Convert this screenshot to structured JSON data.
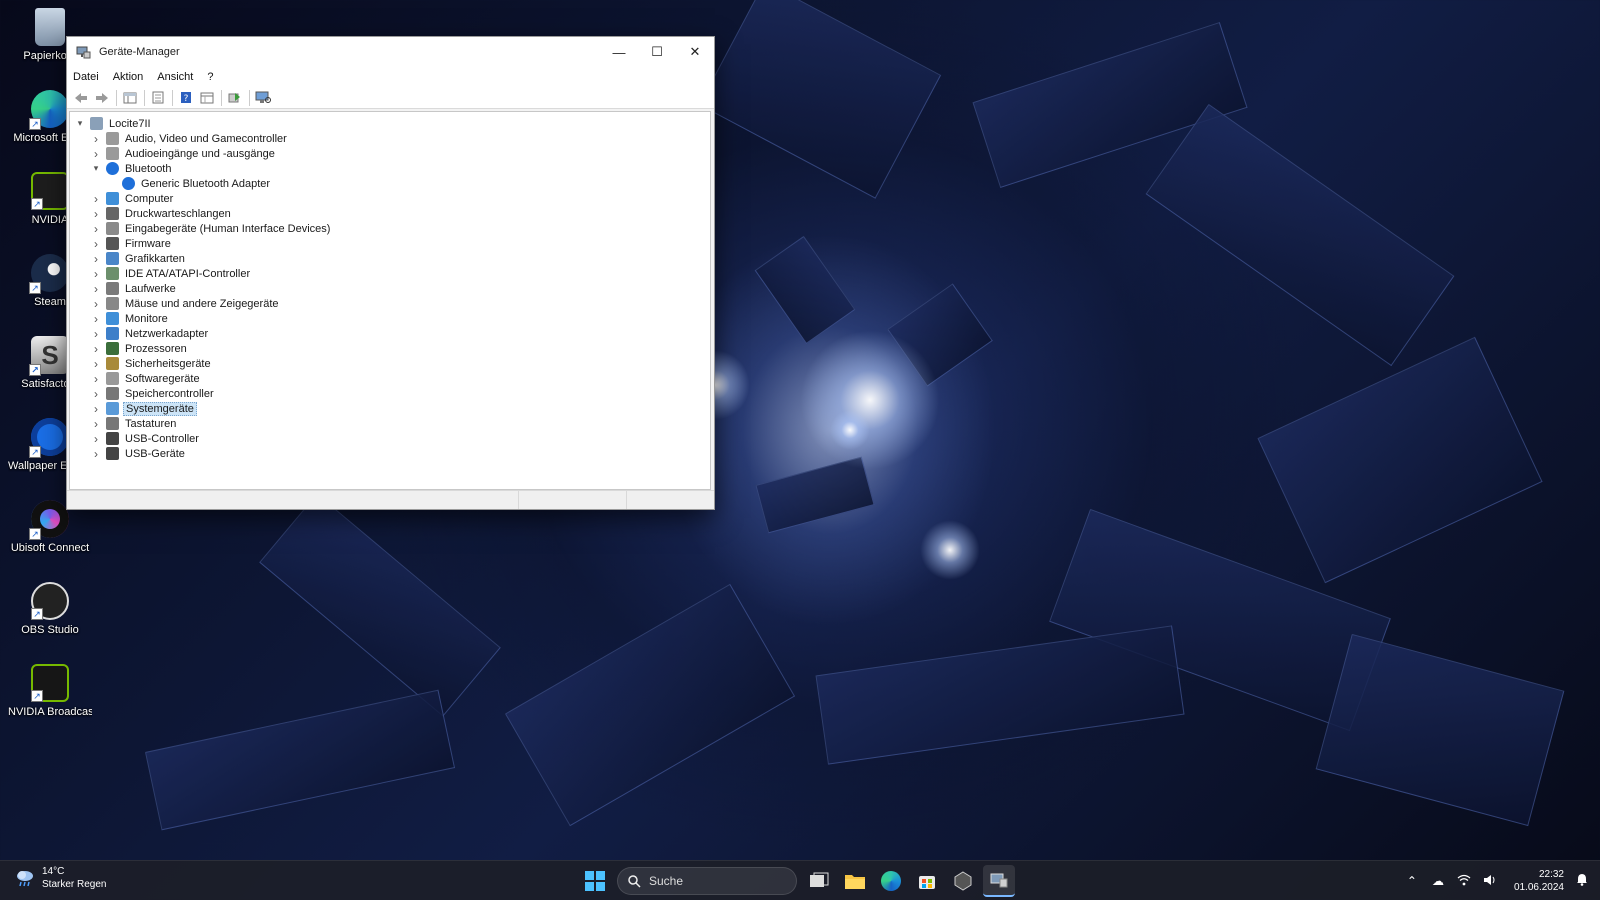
{
  "desktop_icons": [
    {
      "label": "Papierkorb",
      "icon": "recycle-bin-icon"
    },
    {
      "label": "Microsoft Edge",
      "icon": "edge-icon"
    },
    {
      "label": "NVIDIA",
      "icon": "nvidia-icon"
    },
    {
      "label": "Steam",
      "icon": "steam-icon"
    },
    {
      "label": "Satisfactory",
      "icon": "satisfactory-icon"
    },
    {
      "label": "Wallpaper Engine",
      "icon": "wallpaper-engine-icon"
    },
    {
      "label": "Ubisoft Connect",
      "icon": "ubisoft-icon"
    },
    {
      "label": "OBS Studio",
      "icon": "obs-icon"
    },
    {
      "label": "NVIDIA Broadcast",
      "icon": "nvidia-broadcast-icon"
    }
  ],
  "window": {
    "title": "Geräte-Manager",
    "menu": [
      "Datei",
      "Aktion",
      "Ansicht",
      "?"
    ],
    "tree": {
      "root": "Locite7II",
      "items": [
        {
          "label": "Audio, Video und Gamecontroller",
          "icon": "speaker-icon",
          "expanded": false
        },
        {
          "label": "Audioeingänge und -ausgänge",
          "icon": "speaker-icon",
          "expanded": false
        },
        {
          "label": "Bluetooth",
          "icon": "bluetooth-icon",
          "expanded": true,
          "children": [
            "Generic Bluetooth Adapter"
          ]
        },
        {
          "label": "Computer",
          "icon": "monitor-icon",
          "expanded": false
        },
        {
          "label": "Druckwarteschlangen",
          "icon": "printer-icon",
          "expanded": false
        },
        {
          "label": "Eingabegeräte (Human Interface Devices)",
          "icon": "hid-icon",
          "expanded": false
        },
        {
          "label": "Firmware",
          "icon": "chip-icon",
          "expanded": false
        },
        {
          "label": "Grafikkarten",
          "icon": "display-adapter-icon",
          "expanded": false
        },
        {
          "label": "IDE ATA/ATAPI-Controller",
          "icon": "ide-icon",
          "expanded": false
        },
        {
          "label": "Laufwerke",
          "icon": "drive-icon",
          "expanded": false
        },
        {
          "label": "Mäuse und andere Zeigegeräte",
          "icon": "mouse-icon",
          "expanded": false
        },
        {
          "label": "Monitore",
          "icon": "monitor-icon",
          "expanded": false
        },
        {
          "label": "Netzwerkadapter",
          "icon": "network-icon",
          "expanded": false
        },
        {
          "label": "Prozessoren",
          "icon": "cpu-icon",
          "expanded": false
        },
        {
          "label": "Sicherheitsgeräte",
          "icon": "security-icon",
          "expanded": false
        },
        {
          "label": "Softwaregeräte",
          "icon": "software-device-icon",
          "expanded": false
        },
        {
          "label": "Speichercontroller",
          "icon": "storage-controller-icon",
          "expanded": false
        },
        {
          "label": "Systemgeräte",
          "icon": "folder-icon",
          "expanded": false,
          "selected": true
        },
        {
          "label": "Tastaturen",
          "icon": "keyboard-icon",
          "expanded": false
        },
        {
          "label": "USB-Controller",
          "icon": "usb-icon",
          "expanded": false
        },
        {
          "label": "USB-Geräte",
          "icon": "usb-icon",
          "expanded": false
        }
      ]
    }
  },
  "taskbar": {
    "weather": {
      "temp": "14°C",
      "condition": "Starker Regen"
    },
    "search_label": "Suche",
    "clock": {
      "time": "22:32",
      "date": "01.06.2024"
    }
  },
  "colors": {
    "accent": "#0078d4",
    "selection": "#cce4f7",
    "taskbar": "#1c1e28"
  }
}
